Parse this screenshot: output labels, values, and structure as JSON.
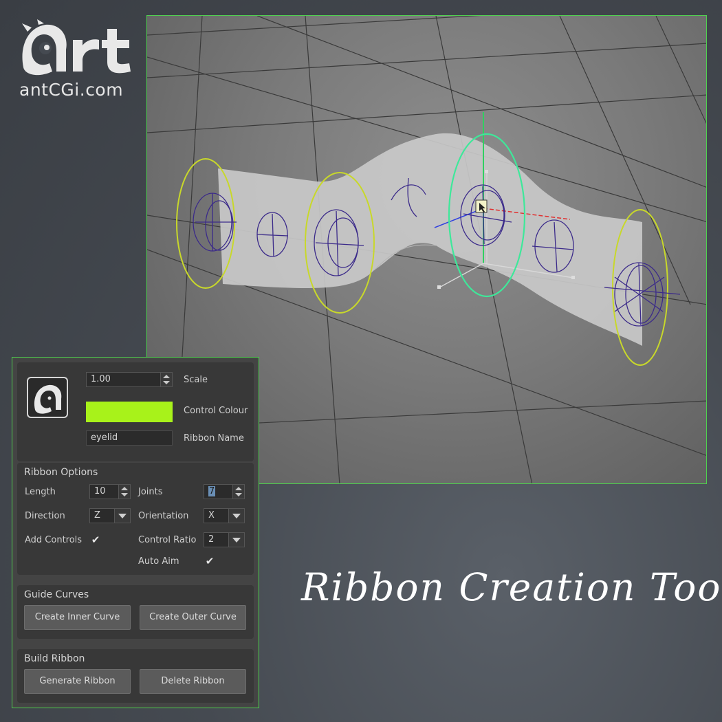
{
  "logo": {
    "mark_text": "Art",
    "url": "antCGi.com"
  },
  "tool": {
    "scale_value": "1.00",
    "scale_label": "Scale",
    "control_colour_label": "Control Colour",
    "control_colour": "#a8f21a",
    "ribbon_name_value": "eyelid",
    "ribbon_name_label": "Ribbon Name",
    "ribbon_options": {
      "title": "Ribbon Options",
      "length_label": "Length",
      "length_value": "10",
      "joints_label": "Joints",
      "joints_value": "7",
      "direction_label": "Direction",
      "direction_value": "Z",
      "orientation_label": "Orientation",
      "orientation_value": "X",
      "add_controls_label": "Add Controls",
      "add_controls_checked": "✔",
      "control_ratio_label": "Control Ratio",
      "control_ratio_value": "2",
      "auto_aim_label": "Auto Aim",
      "auto_aim_checked": "✔"
    },
    "guide_curves": {
      "title": "Guide Curves",
      "inner_button": "Create Inner Curve",
      "outer_button": "Create Outer Curve"
    },
    "build_ribbon": {
      "title": "Build Ribbon",
      "generate_button": "Generate Ribbon",
      "delete_button": "Delete Ribbon"
    }
  },
  "caption": "Ribbon Creation Tool",
  "colors": {
    "viewport_border": "#4fd04f",
    "end_ring": "#c8d82a",
    "mid_ring": "#3ee89a",
    "joint_wire": "#3b2a8a",
    "axis_x": "#e03030",
    "axis_y": "#30d060",
    "axis_z": "#3040e0"
  }
}
